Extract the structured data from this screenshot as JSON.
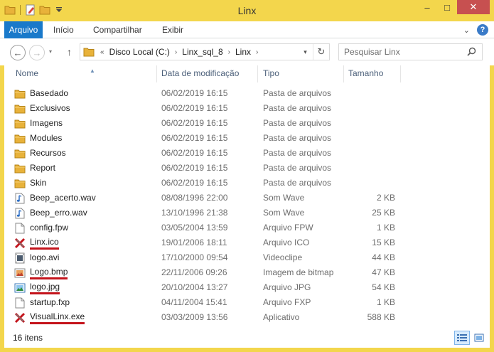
{
  "window": {
    "title": "Linx",
    "controls": {
      "minimize": "–",
      "maximize": "□",
      "close": "✕"
    }
  },
  "ribbon": {
    "tabs": [
      {
        "label": "Arquivo"
      },
      {
        "label": "Início"
      },
      {
        "label": "Compartilhar"
      },
      {
        "label": "Exibir"
      }
    ],
    "collapse_glyph": "⌄",
    "help_glyph": "?"
  },
  "navigation": {
    "back_glyph": "←",
    "forward_glyph": "→",
    "up_glyph": "↑",
    "overflow": "«",
    "breadcrumbs": [
      "Disco Local (C:)",
      "Linx_sql_8",
      "Linx"
    ],
    "crumb_separator": "›",
    "dropdown_glyph": "▾",
    "refresh_glyph": "↻",
    "search_placeholder": "Pesquisar Linx"
  },
  "columns": {
    "name": "Nome",
    "date": "Data de modificação",
    "type": "Tipo",
    "size": "Tamanho",
    "sort_glyph": "▲"
  },
  "files": [
    {
      "name": "Basedado",
      "date": "06/02/2019 16:15",
      "type": "Pasta de arquivos",
      "size": "",
      "icon": "folder-icon"
    },
    {
      "name": "Exclusivos",
      "date": "06/02/2019 16:15",
      "type": "Pasta de arquivos",
      "size": "",
      "icon": "folder-icon"
    },
    {
      "name": "Imagens",
      "date": "06/02/2019 16:15",
      "type": "Pasta de arquivos",
      "size": "",
      "icon": "folder-icon"
    },
    {
      "name": "Modules",
      "date": "06/02/2019 16:15",
      "type": "Pasta de arquivos",
      "size": "",
      "icon": "folder-icon"
    },
    {
      "name": "Recursos",
      "date": "06/02/2019 16:15",
      "type": "Pasta de arquivos",
      "size": "",
      "icon": "folder-icon"
    },
    {
      "name": "Report",
      "date": "06/02/2019 16:15",
      "type": "Pasta de arquivos",
      "size": "",
      "icon": "folder-icon"
    },
    {
      "name": "Skin",
      "date": "06/02/2019 16:15",
      "type": "Pasta de arquivos",
      "size": "",
      "icon": "folder-icon"
    },
    {
      "name": "Beep_acerto.wav",
      "date": "08/08/1996 22:00",
      "type": "Som Wave",
      "size": "2 KB",
      "icon": "audio-file-icon"
    },
    {
      "name": "Beep_erro.wav",
      "date": "13/10/1996 21:38",
      "type": "Som Wave",
      "size": "25 KB",
      "icon": "audio-file-icon"
    },
    {
      "name": "config.fpw",
      "date": "03/05/2004 13:59",
      "type": "Arquivo FPW",
      "size": "1 KB",
      "icon": "blank-file-icon"
    },
    {
      "name": "Linx.ico",
      "date": "19/01/2006 18:11",
      "type": "Arquivo ICO",
      "size": "15 KB",
      "icon": "linx-app-icon",
      "highlighted": true
    },
    {
      "name": "logo.avi",
      "date": "17/10/2000 09:54",
      "type": "Videoclipe",
      "size": "44 KB",
      "icon": "video-file-icon"
    },
    {
      "name": "Logo.bmp",
      "date": "22/11/2006 09:26",
      "type": "Imagem de bitmap",
      "size": "47 KB",
      "icon": "bitmap-file-icon",
      "highlighted": true
    },
    {
      "name": "logo.jpg",
      "date": "20/10/2004 13:27",
      "type": "Arquivo JPG",
      "size": "54 KB",
      "icon": "jpg-file-icon",
      "highlighted": true
    },
    {
      "name": "startup.fxp",
      "date": "04/11/2004 15:41",
      "type": "Arquivo FXP",
      "size": "1 KB",
      "icon": "blank-file-icon"
    },
    {
      "name": "VisualLinx.exe",
      "date": "03/03/2009 13:56",
      "type": "Aplicativo",
      "size": "588 KB",
      "icon": "linx-app-icon",
      "highlighted": true
    }
  ],
  "status": {
    "item_count": "16 itens"
  },
  "colors": {
    "title_bar": "#f3d64c",
    "file_tab": "#1979ca",
    "close_button": "#c75050",
    "column_header_text": "#4c607a",
    "highlight_underline": "#c4141c"
  }
}
